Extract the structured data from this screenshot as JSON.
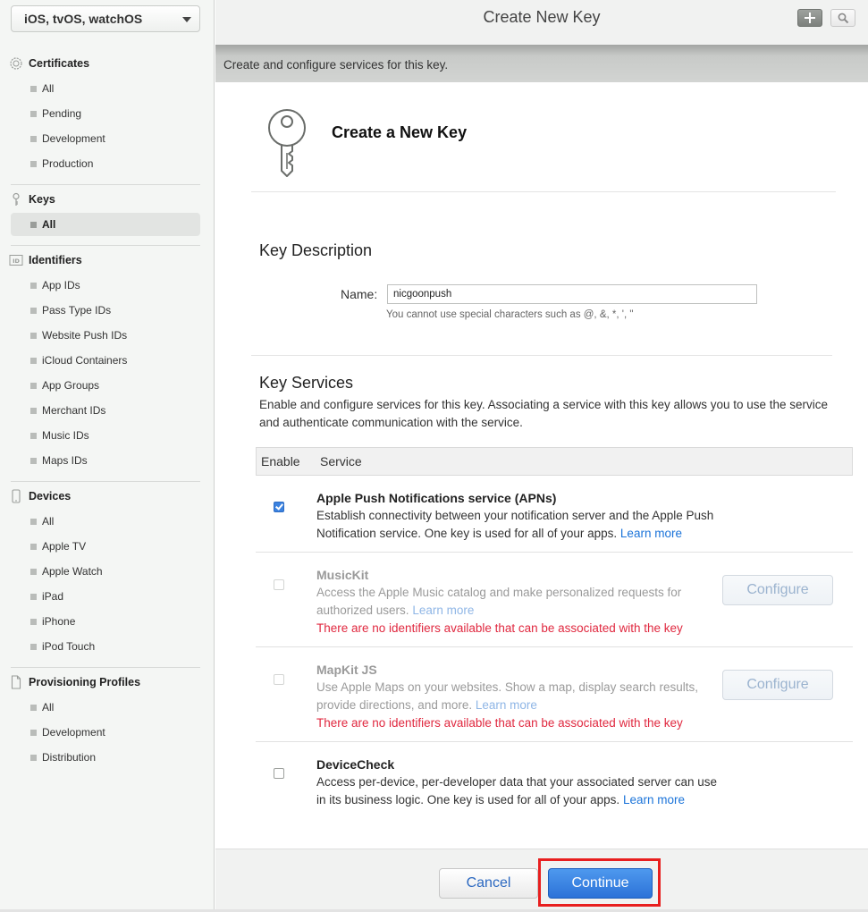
{
  "sidebar": {
    "platform": "iOS, tvOS, watchOS",
    "sections": [
      {
        "title": "Certificates",
        "icon": "certificate-icon",
        "items": [
          "All",
          "Pending",
          "Development",
          "Production"
        ]
      },
      {
        "title": "Keys",
        "icon": "key-icon",
        "items": [
          "All"
        ],
        "selected": "All"
      },
      {
        "title": "Identifiers",
        "icon": "id-icon",
        "items": [
          "App IDs",
          "Pass Type IDs",
          "Website Push IDs",
          "iCloud Containers",
          "App Groups",
          "Merchant IDs",
          "Music IDs",
          "Maps IDs"
        ]
      },
      {
        "title": "Devices",
        "icon": "device-icon",
        "items": [
          "All",
          "Apple TV",
          "Apple Watch",
          "iPad",
          "iPhone",
          "iPod Touch"
        ]
      },
      {
        "title": "Provisioning Profiles",
        "icon": "document-icon",
        "items": [
          "All",
          "Development",
          "Distribution"
        ]
      }
    ]
  },
  "header": {
    "title": "Create New Key",
    "add_icon": "plus-icon",
    "search_icon": "search-icon"
  },
  "infobar": "Create and configure services for this key.",
  "page": {
    "heading": "Create a New Key",
    "key_description_title": "Key Description",
    "name_label": "Name:",
    "name_value": "nicgoonpush",
    "name_hint": "You cannot use special characters such as @, &, *, ', \"",
    "key_services_title": "Key Services",
    "key_services_intro": "Enable and configure services for this key. Associating a service with this key allows you to use the service and authenticate communication with the service.",
    "table_headers": {
      "enable": "Enable",
      "service": "Service"
    }
  },
  "services": [
    {
      "name": "Apple Push Notifications service (APNs)",
      "description": "Establish connectivity between your notification server and the Apple Push Notification service. One key is used for all of your apps.",
      "link": "Learn more",
      "checked": true,
      "enabled": true
    },
    {
      "name": "MusicKit",
      "description": "Access the Apple Music catalog and make personalized requests for authorized users.",
      "link": "Learn more",
      "warning": "There are no identifiers available that can be associated with the key",
      "configure_label": "Configure",
      "checked": false,
      "enabled": false
    },
    {
      "name": "MapKit JS",
      "description": "Use Apple Maps on your websites. Show a map, display search results, provide directions, and more.",
      "link": "Learn more",
      "warning": "There are no identifiers available that can be associated with the key",
      "configure_label": "Configure",
      "checked": false,
      "enabled": false
    },
    {
      "name": "DeviceCheck",
      "description": "Access per-device, per-developer data that your associated server can use in its business logic. One key is used for all of your apps.",
      "link": "Learn more",
      "checked": false,
      "enabled": true
    }
  ],
  "footer": {
    "cancel_label": "Cancel",
    "continue_label": "Continue"
  },
  "colors": {
    "accent": "#2c72d8",
    "warning": "#e0283f",
    "highlight": "#e81f1f"
  }
}
